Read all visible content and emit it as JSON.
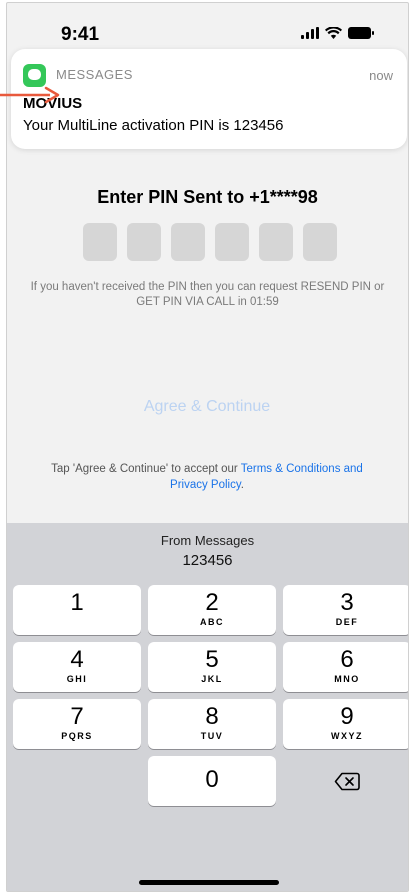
{
  "status_bar": {
    "time": "9:41"
  },
  "notification": {
    "app_name": "MESSAGES",
    "time": "now",
    "title": "MOVIUS",
    "body": "Your MultiLine activation PIN is 123456"
  },
  "main": {
    "title": "Enter PIN Sent to +1****98",
    "pin_length": 6,
    "resend_info": "If you haven't received the PIN then you can request RESEND PIN or GET PIN VIA CALL in 01:59",
    "agree_button": "Agree & Continue",
    "terms_prefix": "Tap 'Agree & Continue' to accept our ",
    "terms_link": "Terms & Conditions and Privacy Policy",
    "terms_suffix": "."
  },
  "keyboard": {
    "suggestion_label": "From Messages",
    "suggestion_code": "123456",
    "keys": [
      {
        "num": "1",
        "letters": ""
      },
      {
        "num": "2",
        "letters": "ABC"
      },
      {
        "num": "3",
        "letters": "DEF"
      },
      {
        "num": "4",
        "letters": "GHI"
      },
      {
        "num": "5",
        "letters": "JKL"
      },
      {
        "num": "6",
        "letters": "MNO"
      },
      {
        "num": "7",
        "letters": "PQRS"
      },
      {
        "num": "8",
        "letters": "TUV"
      },
      {
        "num": "9",
        "letters": "WXYZ"
      },
      {
        "num": "0",
        "letters": ""
      }
    ]
  },
  "colors": {
    "accent": "#1a73e8",
    "disabled_button": "#bcd3f2",
    "annotation_arrow": "#e8593c",
    "messages_icon": "#34c759"
  }
}
